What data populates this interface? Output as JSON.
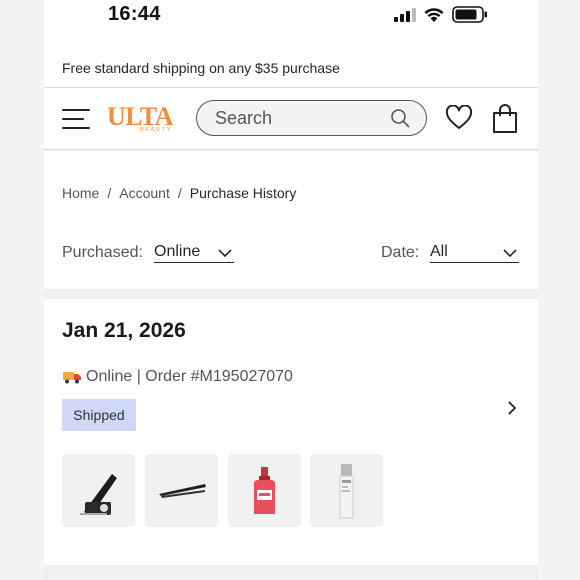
{
  "status_bar": {
    "time": "16:44"
  },
  "promo": {
    "text": "Free standard shipping on any $35 purchase"
  },
  "header": {
    "logo_text": "ULTA",
    "logo_sub": "BEAUTY",
    "search_placeholder": "Search",
    "icons": [
      "menu-icon",
      "search-icon",
      "heart-icon",
      "bag-icon"
    ]
  },
  "breadcrumb": [
    {
      "label": "Home"
    },
    {
      "label": "Account"
    },
    {
      "label": "Purchase History"
    }
  ],
  "filters": {
    "purchased_label": "Purchased:",
    "purchased_value": "Online",
    "date_label": "Date:",
    "date_value": "All"
  },
  "order": {
    "date": "Jan 21, 2026",
    "channel": "Online",
    "order_text": "Online | Order #M195027070",
    "status": "Shipped",
    "items": [
      {
        "icon": "nail-clipper-icon"
      },
      {
        "icon": "tweezers-icon"
      },
      {
        "icon": "red-serum-bottle-icon"
      },
      {
        "icon": "silver-serum-tube-icon"
      }
    ]
  },
  "colors": {
    "brand": "#f48c3c",
    "status_badge": "#cfd8f7"
  }
}
